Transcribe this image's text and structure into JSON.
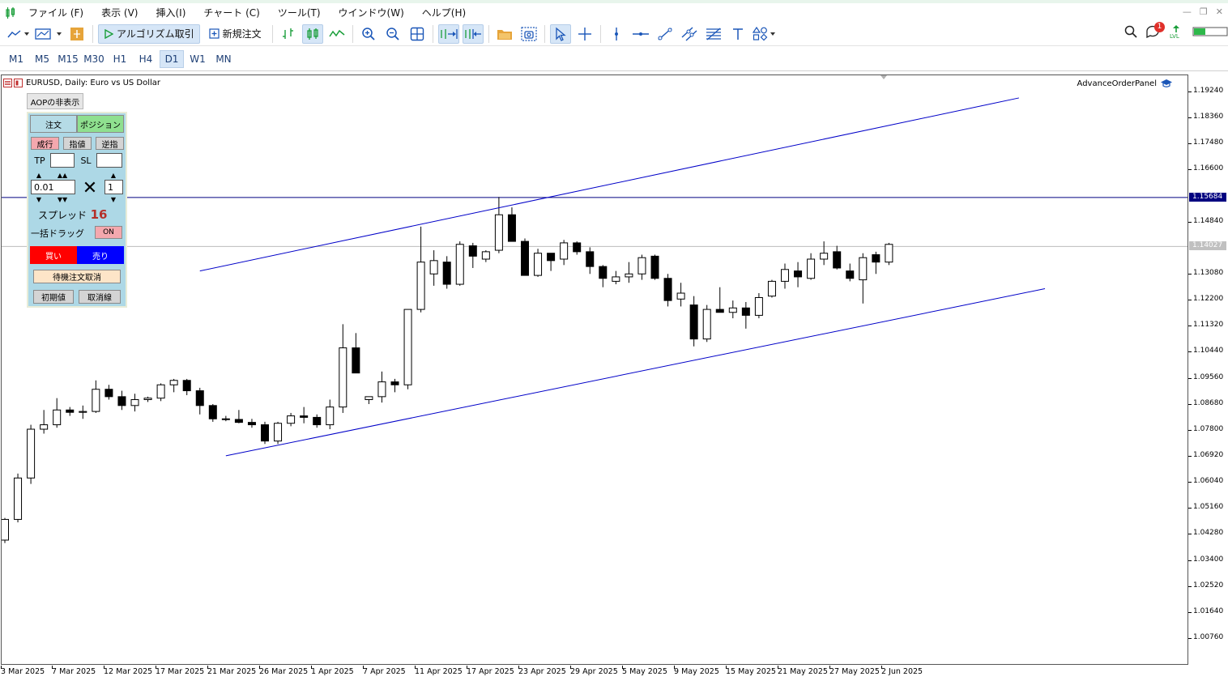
{
  "menu": {
    "items": [
      "ファイル (F)",
      "表示 (V)",
      "挿入(I)",
      "チャート (C)",
      "ツール(T)",
      "ウインドウ(W)",
      "ヘルプ(H)"
    ]
  },
  "toolbar": {
    "algo_label": "アルゴリズム取引",
    "new_order_label": "新規注文",
    "notification_count": "1"
  },
  "timeframes": [
    "M1",
    "M5",
    "M15",
    "M30",
    "H1",
    "H4",
    "D1",
    "W1",
    "MN"
  ],
  "active_timeframe": "D1",
  "chart": {
    "title": "EURUSD, Daily:  Euro vs US Dollar",
    "indicator_label": "AdvanceOrderPanel",
    "hline_price": "1.15684",
    "current_price": "1.14027"
  },
  "panel": {
    "toggle_label": "AOPの非表示",
    "tab_order": "注文",
    "tab_position": "ポジション",
    "btn_market": "成行",
    "btn_limit": "指値",
    "btn_stop": "逆指",
    "tp_label": "TP",
    "sl_label": "SL",
    "lot_value": "0.01",
    "multiplier_symbol": "✕",
    "count_value": "1",
    "spread_label": "スプレッド",
    "spread_value": "16",
    "bulk_drag_label": "一括ドラッグ",
    "bulk_drag_state": "ON",
    "buy_label": "買い",
    "sell_label": "売り",
    "cancel_pending_label": "待機注文取消",
    "reset_label": "初期値",
    "cancel_line_label": "取消線"
  },
  "chart_data": {
    "type": "candlestick",
    "title": "EURUSD, Daily:  Euro vs US Dollar",
    "y_ticks": [
      "1.19240",
      "1.18360",
      "1.17480",
      "1.16600",
      "1.14840",
      "1.13080",
      "1.12200",
      "1.11320",
      "1.10440",
      "1.09560",
      "1.08680",
      "1.07800",
      "1.06920",
      "1.06040",
      "1.05160",
      "1.04280",
      "1.03400",
      "1.02520",
      "1.01640",
      "1.00760"
    ],
    "ylim": [
      1.0,
      1.196
    ],
    "x_ticks": [
      "3 Mar 2025",
      "7 Mar 2025",
      "12 Mar 2025",
      "17 Mar 2025",
      "21 Mar 2025",
      "26 Mar 2025",
      "1 Apr 2025",
      "7 Apr 2025",
      "11 Apr 2025",
      "17 Apr 2025",
      "23 Apr 2025",
      "29 Apr 2025",
      "5 May 2025",
      "9 May 2025",
      "15 May 2025",
      "21 May 2025",
      "27 May 2025",
      "2 Jun 2025"
    ],
    "candles": [
      [
        1.041,
        1.0485,
        1.04,
        1.048
      ],
      [
        1.048,
        1.0635,
        1.047,
        1.062
      ],
      [
        1.062,
        1.08,
        1.06,
        1.0785
      ],
      [
        1.0785,
        1.085,
        1.077,
        1.08
      ],
      [
        1.08,
        1.089,
        1.079,
        1.085
      ],
      [
        1.085,
        1.086,
        1.083,
        1.0842
      ],
      [
        1.0842,
        1.0865,
        1.082,
        1.0845
      ],
      [
        1.0845,
        1.095,
        1.084,
        1.092
      ],
      [
        1.092,
        1.0935,
        1.0885,
        1.0895
      ],
      [
        1.0895,
        1.0915,
        1.085,
        1.0865
      ],
      [
        1.0865,
        1.0905,
        1.0845,
        1.0885
      ],
      [
        1.0885,
        1.0895,
        1.0877,
        1.089
      ],
      [
        1.089,
        1.094,
        1.088,
        1.0935
      ],
      [
        1.0935,
        1.0955,
        1.091,
        1.095
      ],
      [
        1.095,
        1.0955,
        1.09,
        1.0915
      ],
      [
        1.0915,
        1.0925,
        1.0835,
        1.0865
      ],
      [
        1.0865,
        1.087,
        1.081,
        1.082
      ],
      [
        1.082,
        1.083,
        1.0812,
        1.0818
      ],
      [
        1.0818,
        1.085,
        1.0805,
        1.0808
      ],
      [
        1.0808,
        1.082,
        1.079,
        1.08
      ],
      [
        1.08,
        1.081,
        1.0735,
        1.0745
      ],
      [
        1.0745,
        1.081,
        1.0735,
        1.0805
      ],
      [
        1.0805,
        1.084,
        1.0795,
        1.083
      ],
      [
        1.083,
        1.086,
        1.0805,
        1.0825
      ],
      [
        1.0825,
        1.0835,
        1.079,
        1.08
      ],
      [
        1.08,
        1.0885,
        1.0785,
        1.086
      ],
      [
        1.086,
        1.114,
        1.084,
        1.106
      ],
      [
        1.106,
        1.111,
        1.101,
        1.0975
      ],
      [
        1.0885,
        1.0895,
        1.087,
        1.0895
      ],
      [
        1.0895,
        1.098,
        1.0875,
        1.0945
      ],
      [
        1.0945,
        1.0955,
        1.091,
        1.0935
      ],
      [
        1.0935,
        1.1185,
        1.092,
        1.119
      ],
      [
        1.119,
        1.147,
        1.118,
        1.135
      ],
      [
        1.131,
        1.139,
        1.127,
        1.1355
      ],
      [
        1.135,
        1.137,
        1.126,
        1.1275
      ],
      [
        1.1275,
        1.142,
        1.127,
        1.141
      ],
      [
        1.1405,
        1.1415,
        1.133,
        1.137
      ],
      [
        1.136,
        1.139,
        1.135,
        1.1385
      ],
      [
        1.139,
        1.157,
        1.138,
        1.151
      ],
      [
        1.151,
        1.1535,
        1.142,
        1.142
      ],
      [
        1.142,
        1.143,
        1.1305,
        1.1305
      ],
      [
        1.1305,
        1.1395,
        1.13,
        1.138
      ],
      [
        1.138,
        1.138,
        1.132,
        1.1355
      ],
      [
        1.136,
        1.1425,
        1.134,
        1.1415
      ],
      [
        1.1415,
        1.142,
        1.1375,
        1.1385
      ],
      [
        1.1385,
        1.14,
        1.131,
        1.1335
      ],
      [
        1.1335,
        1.134,
        1.1265,
        1.1295
      ],
      [
        1.1285,
        1.132,
        1.1275,
        1.13
      ],
      [
        1.13,
        1.135,
        1.128,
        1.131
      ],
      [
        1.131,
        1.1375,
        1.129,
        1.1365
      ],
      [
        1.137,
        1.1375,
        1.129,
        1.1295
      ],
      [
        1.1295,
        1.131,
        1.12,
        1.122
      ],
      [
        1.1225,
        1.128,
        1.12,
        1.1245
      ],
      [
        1.1205,
        1.1235,
        1.1065,
        1.109
      ],
      [
        1.109,
        1.1205,
        1.108,
        1.119
      ],
      [
        1.119,
        1.1265,
        1.1185,
        1.118
      ],
      [
        1.118,
        1.122,
        1.116,
        1.1195
      ],
      [
        1.1195,
        1.1215,
        1.1125,
        1.117
      ],
      [
        1.117,
        1.1245,
        1.116,
        1.123
      ],
      [
        1.1235,
        1.129,
        1.123,
        1.1285
      ],
      [
        1.1285,
        1.1345,
        1.126,
        1.1325
      ],
      [
        1.132,
        1.135,
        1.1265,
        1.13
      ],
      [
        1.1295,
        1.138,
        1.129,
        1.136
      ],
      [
        1.136,
        1.142,
        1.134,
        1.138
      ],
      [
        1.1385,
        1.1405,
        1.1325,
        1.133
      ],
      [
        1.132,
        1.1345,
        1.1285,
        1.1295
      ],
      [
        1.129,
        1.138,
        1.121,
        1.1365
      ],
      [
        1.1375,
        1.1385,
        1.131,
        1.135
      ],
      [
        1.135,
        1.1415,
        1.134,
        1.141
      ]
    ],
    "trendlines": [
      {
        "from": [
          17,
          1.0695
        ],
        "to": [
          80,
          1.126
        ]
      },
      {
        "from": [
          15,
          1.132
        ],
        "to": [
          78,
          1.1905
        ]
      }
    ]
  }
}
